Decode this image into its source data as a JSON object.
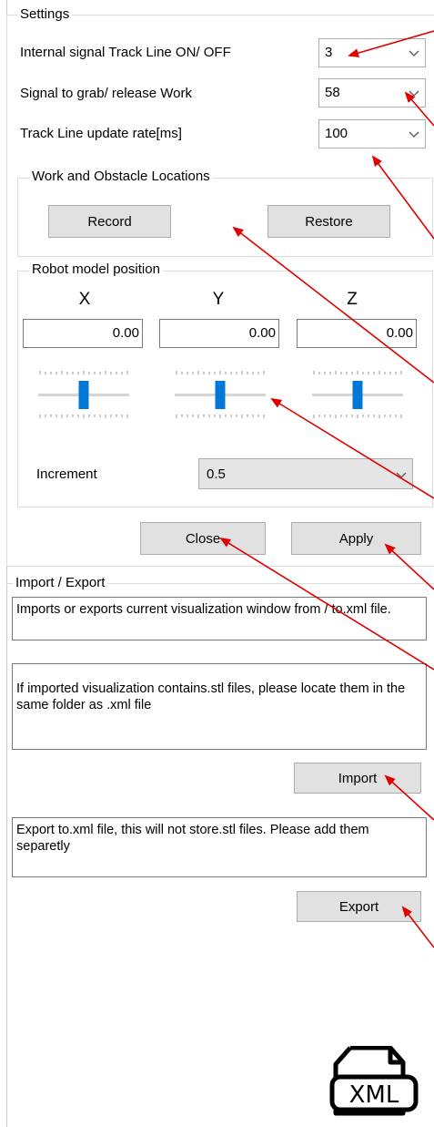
{
  "settings": {
    "legend": "Settings",
    "track_line_label": "Internal signal Track Line ON/ OFF",
    "track_line_value": "3",
    "grab_label": "Signal to grab/ release Work",
    "grab_value": "58",
    "rate_label": "Track Line update rate[ms]",
    "rate_value": "100"
  },
  "work_locations": {
    "legend": "Work and Obstacle Locations",
    "record_label": "Record",
    "restore_label": "Restore"
  },
  "robot_position": {
    "legend": "Robot model position",
    "x_label": "X",
    "y_label": "Y",
    "z_label": "Z",
    "x_value": "0.00",
    "y_value": "0.00",
    "z_value": "0.00",
    "x_slider_level": 0.5,
    "y_slider_level": 0.5,
    "z_slider_level": 0.5,
    "increment_label": "Increment",
    "increment_value": "0.5"
  },
  "actions": {
    "close_label": "Close",
    "apply_label": "Apply"
  },
  "import_export": {
    "legend": "Import / Export",
    "info_text": "Imports or exports current visualization window from / to.xml file.",
    "import_note": "If imported visualization contains.stl files, please locate them in the same folder as .xml file",
    "import_label": "Import",
    "export_note": "Export to.xml file, this will not store.stl files. Please add them separetly",
    "export_label": "Export",
    "xml_icon_text": "XML"
  },
  "colors": {
    "arrow": "#e00000",
    "slider_thumb": "#0078d7",
    "button_bg": "#e1e1e1"
  }
}
